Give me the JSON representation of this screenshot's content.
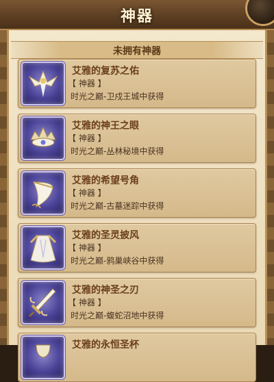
{
  "header": {
    "title": "神器"
  },
  "section": {
    "label": "未拥有神器"
  },
  "items": [
    {
      "name": "艾雅的复苏之佑",
      "tag": "【 神器 】",
      "source": "时光之巅-卫戍王城中获得",
      "icon": "winged-relic-icon"
    },
    {
      "name": "艾雅的神王之眼",
      "tag": "【 神器 】",
      "source": "时光之巅-丛林秘境中获得",
      "icon": "crown-eye-icon"
    },
    {
      "name": "艾雅的希望号角",
      "tag": "【 神器 】",
      "source": "时光之巅-古墓迷踪中获得",
      "icon": "horn-icon"
    },
    {
      "name": "艾雅的圣灵披风",
      "tag": "【 神器 】",
      "source": "时光之巅-鸦巢峡谷中获得",
      "icon": "cloak-icon"
    },
    {
      "name": "艾雅的神圣之刃",
      "tag": "【 神器 】",
      "source": "时光之巅-蝮蛇沼地中获得",
      "icon": "blade-icon"
    },
    {
      "name": "艾雅的永恒圣杯",
      "tag": "",
      "source": "",
      "icon": "chalice-icon"
    }
  ],
  "colors": {
    "title_bar": "#5b3d22",
    "panel": "#f3e7cc",
    "card": "#d4b98a",
    "name_text": "#6a3f1a",
    "icon_bg": "#4a4296"
  }
}
